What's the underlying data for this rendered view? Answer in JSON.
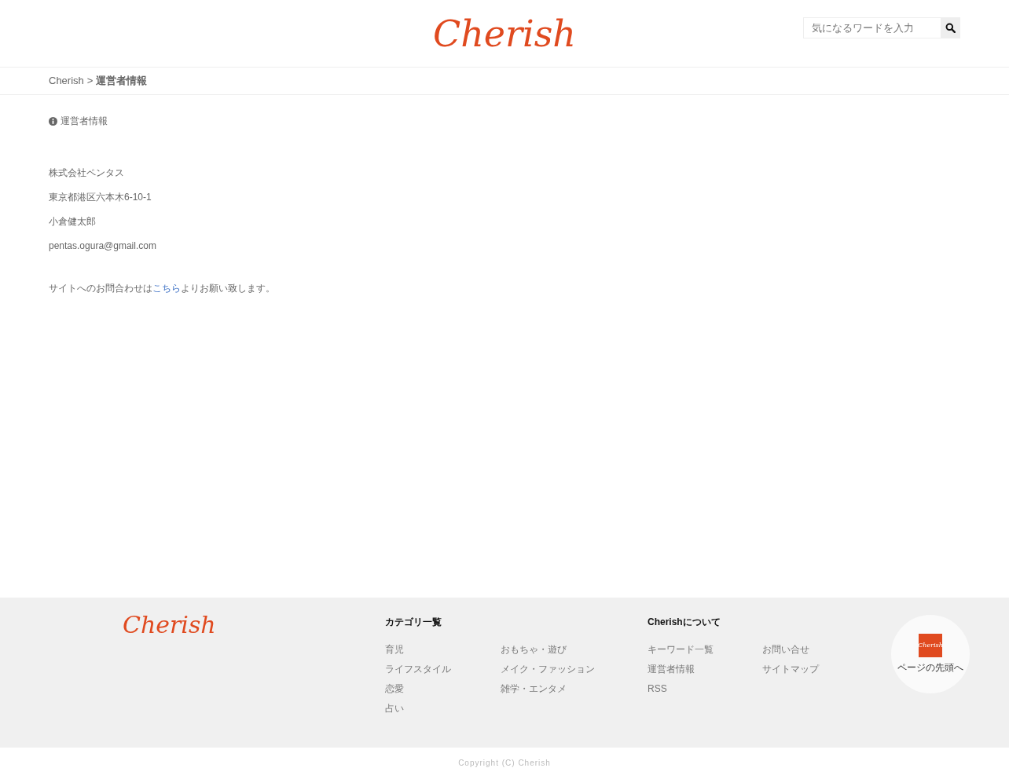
{
  "header": {
    "logo": "Cherish",
    "search": {
      "placeholder": "気になるワードを入力"
    }
  },
  "breadcrumb": [
    {
      "label": "Cherish",
      "current": false
    },
    {
      "label": "運営者情報",
      "current": true
    }
  ],
  "breadcrumb_separator": ">",
  "page_title": "運営者情報",
  "info_lines": [
    "株式会社ペンタス",
    "東京都港区六本木6-10-1",
    "小倉健太郎",
    "pentas.ogura@gmail.com"
  ],
  "contact_note": {
    "before": "サイトへのお問合わせは",
    "link": "こちら",
    "after": "よりお願い致します。"
  },
  "footer": {
    "logo": "Cherish",
    "sections": [
      {
        "title": "カテゴリ一覧",
        "columns": [
          [
            "育児",
            "ライフスタイル",
            "恋愛",
            "占い"
          ],
          [
            "おもちゃ・遊び",
            "メイク・ファッション",
            "雑学・エンタメ"
          ]
        ]
      },
      {
        "title": "Cherishについて",
        "columns": [
          [
            "キーワード一覧",
            "運営者情報",
            "RSS"
          ],
          [
            "お問い合せ",
            "サイトマップ"
          ]
        ]
      }
    ],
    "back_to_top": {
      "logo": "Cherish",
      "label": "ページの先頭へ"
    }
  },
  "copyright": "Copyright (C) Cherish"
}
